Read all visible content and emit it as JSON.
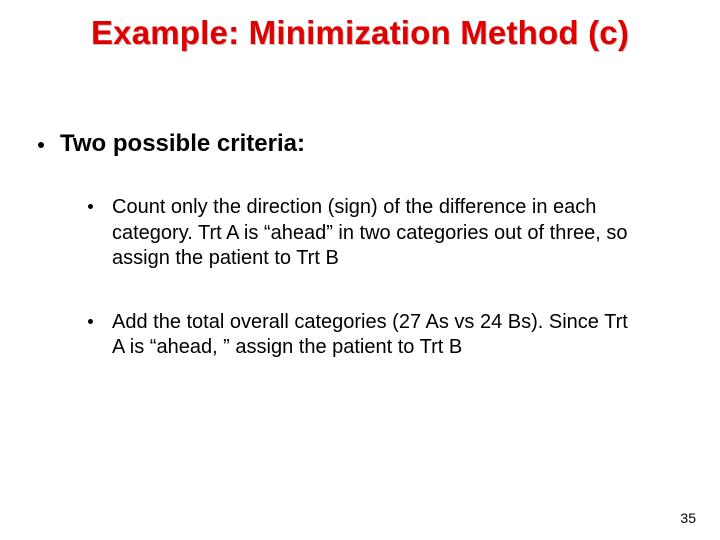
{
  "title": "Example: Minimization Method (c)",
  "main_bullet": "Two possible criteria:",
  "sub_bullets": [
    "Count only the direction (sign) of the difference in each category.  Trt A is “ahead” in two categories out of three, so assign the patient to Trt B",
    "Add the total overall categories (27 As vs 24 Bs).  Since Trt A is “ahead, ” assign the patient to Trt B"
  ],
  "page_number": "35"
}
